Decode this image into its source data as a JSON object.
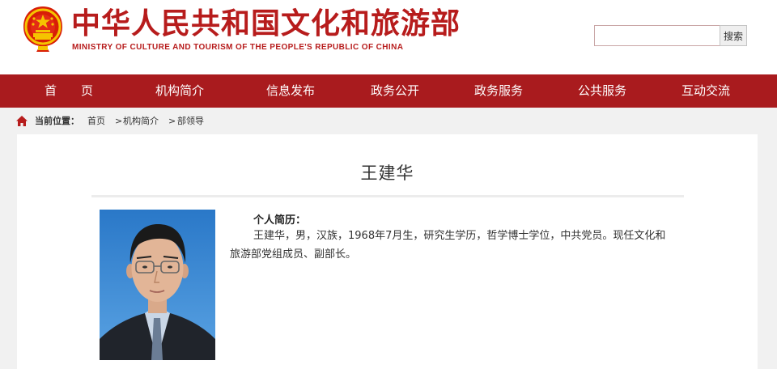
{
  "header": {
    "title": "中华人民共和国文化和旅游部",
    "subtitle": "MINISTRY OF CULTURE AND TOURISM OF THE PEOPLE'S REPUBLIC OF CHINA",
    "emblem_icon": "national-emblem",
    "search": {
      "value": "",
      "placeholder": "",
      "button_label": "搜索"
    },
    "colors": {
      "brand_red": "#b71c1c"
    }
  },
  "nav": {
    "items": [
      {
        "label": "首　　页"
      },
      {
        "label": "机构简介"
      },
      {
        "label": "信息发布"
      },
      {
        "label": "政务公开"
      },
      {
        "label": "政务服务"
      },
      {
        "label": "公共服务"
      },
      {
        "label": "互动交流"
      }
    ],
    "colors": {
      "background": "#a91b1e",
      "text": "#ffffff"
    }
  },
  "breadcrumb": {
    "icon": "home-icon",
    "prefix": "当前位置：",
    "items": [
      "首页",
      "机构简介",
      "部领导"
    ],
    "separator": ">"
  },
  "profile": {
    "name": "王建华",
    "bio_heading": "个人简历：",
    "bio_text": "王建华，男，汉族，1968年7月生，研究生学历，哲学博士学位，中共党员。现任文化和旅游部党组成员、副部长。"
  }
}
